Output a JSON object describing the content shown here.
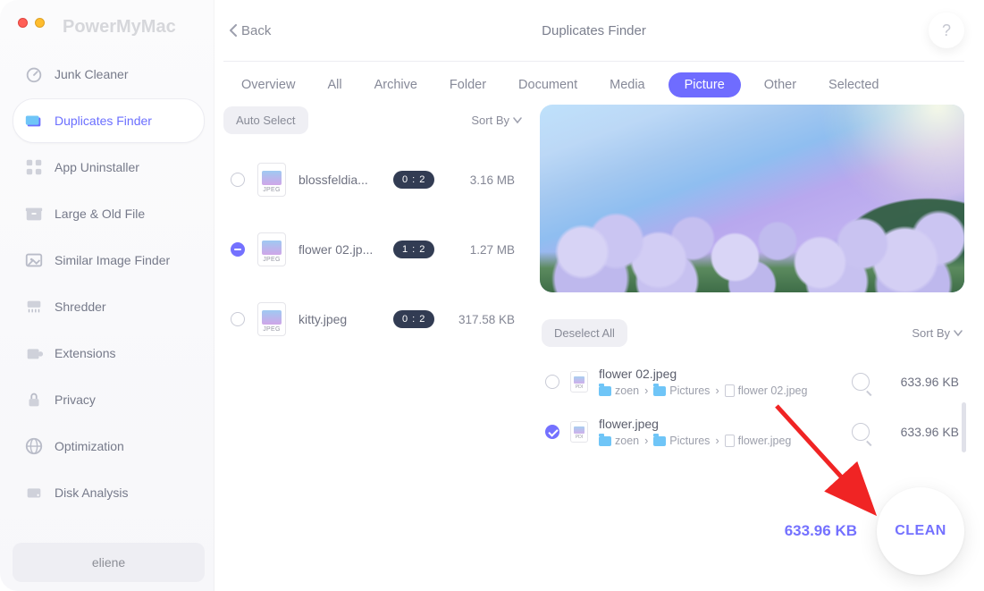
{
  "brand": "PowerMyMac",
  "back_label": "Back",
  "page_title": "Duplicates Finder",
  "help_label": "?",
  "sidebar": {
    "items": [
      {
        "label": "Junk Cleaner",
        "icon": "speedometer-icon",
        "active": false
      },
      {
        "label": "Duplicates Finder",
        "icon": "folder-stack-icon",
        "active": true
      },
      {
        "label": "App Uninstaller",
        "icon": "app-grid-icon",
        "active": false
      },
      {
        "label": "Large & Old File",
        "icon": "archive-box-icon",
        "active": false
      },
      {
        "label": "Similar Image Finder",
        "icon": "image-icon",
        "active": false
      },
      {
        "label": "Shredder",
        "icon": "shredder-icon",
        "active": false
      },
      {
        "label": "Extensions",
        "icon": "puzzle-icon",
        "active": false
      },
      {
        "label": "Privacy",
        "icon": "lock-icon",
        "active": false
      },
      {
        "label": "Optimization",
        "icon": "globe-icon",
        "active": false
      },
      {
        "label": "Disk Analysis",
        "icon": "disk-icon",
        "active": false
      }
    ],
    "user": "eliene"
  },
  "tabs": [
    {
      "label": "Overview",
      "active": false
    },
    {
      "label": "All",
      "active": false
    },
    {
      "label": "Archive",
      "active": false
    },
    {
      "label": "Folder",
      "active": false
    },
    {
      "label": "Document",
      "active": false
    },
    {
      "label": "Media",
      "active": false
    },
    {
      "label": "Picture",
      "active": true
    },
    {
      "label": "Other",
      "active": false
    },
    {
      "label": "Selected",
      "active": false
    }
  ],
  "list": {
    "auto_select_label": "Auto Select",
    "sort_label": "Sort By",
    "rows": [
      {
        "name": "blossfeldia...",
        "badge": "0 : 2",
        "size": "3.16 MB",
        "state": "empty",
        "ext": "JPEG"
      },
      {
        "name": "flower 02.jp...",
        "badge": "1 : 2",
        "size": "1.27 MB",
        "state": "partial",
        "ext": "JPEG"
      },
      {
        "name": "kitty.jpeg",
        "badge": "0 : 2",
        "size": "317.58 KB",
        "state": "empty",
        "ext": "JPEG"
      }
    ]
  },
  "detail": {
    "deselect_label": "Deselect All",
    "sort_label": "Sort By",
    "rows": [
      {
        "name": "flower 02.jpeg",
        "path_segments": [
          "zoen",
          "Pictures",
          "flower 02.jpeg"
        ],
        "size": "633.96 KB",
        "checked": false
      },
      {
        "name": "flower.jpeg",
        "path_segments": [
          "zoen",
          "Pictures",
          "flower.jpeg"
        ],
        "size": "633.96 KB",
        "checked": true
      }
    ]
  },
  "total_selected": "633.96 KB",
  "clean_label": "CLEAN"
}
